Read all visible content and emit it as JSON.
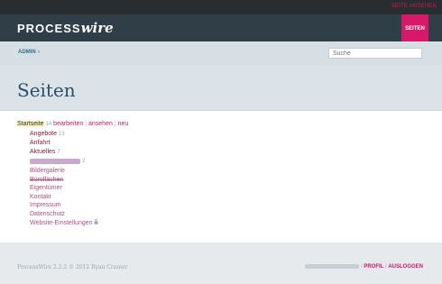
{
  "top": {
    "view_site": "SEITE ANSEHEN"
  },
  "header": {
    "logo_prefix": "PROCESS",
    "logo_suffix": "wire",
    "tab_pages": "SEITEN"
  },
  "subnav": {
    "admin_label": "ADMIN",
    "admin_arrow": "»",
    "search_placeholder": "Suche"
  },
  "title": "Seiten",
  "tree": {
    "root": {
      "label": "Startseite",
      "count": "14",
      "actions": [
        "bearbeiten",
        "ansehen",
        "neu"
      ]
    },
    "children": [
      {
        "label": "Angebote",
        "count": "13",
        "style": "dark"
      },
      {
        "label": "Anfahrt",
        "count": "",
        "style": "dark"
      },
      {
        "label": "Aktuelles",
        "count": "7",
        "style": "dark"
      },
      {
        "label": "",
        "count": "2",
        "style": "blurred"
      },
      {
        "label": "Bildergalerie",
        "count": "",
        "style": "light"
      },
      {
        "label": "Büroflächen",
        "count": "",
        "style": "light-strike"
      },
      {
        "label": "Eigentümer",
        "count": "",
        "style": "light"
      },
      {
        "label": "Kontakt",
        "count": "",
        "style": "light"
      },
      {
        "label": "Impressum",
        "count": "",
        "style": "light"
      },
      {
        "label": "Datenschutz",
        "count": "",
        "style": "light"
      },
      {
        "label": "Website-Einstellungen",
        "count": "",
        "style": "light-locked"
      }
    ],
    "lock_icon": "lock-icon"
  },
  "footer": {
    "copyright": "ProcessWire 2.2.2 © 2012 Ryan Cramer",
    "profile": "PROFIL",
    "logout": "AUSLOGGEN",
    "separator": "/"
  },
  "colors": {
    "accent": "#d6196b",
    "header_bg": "#2f3e47",
    "title": "#2a4e6b"
  }
}
